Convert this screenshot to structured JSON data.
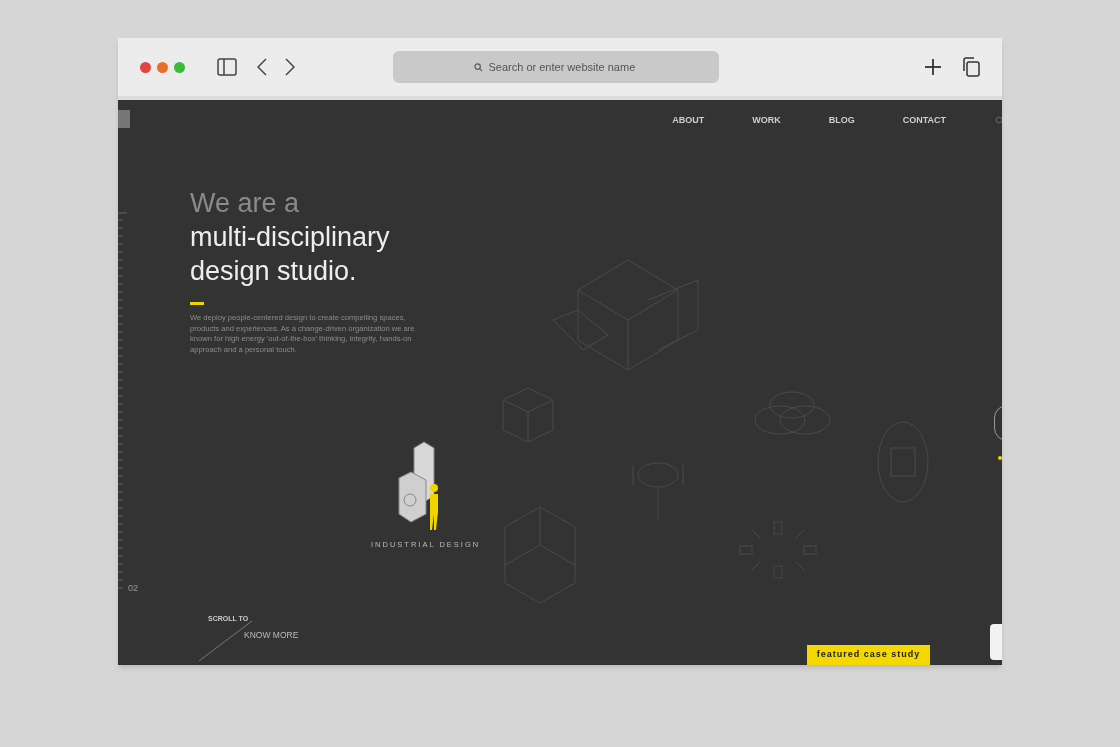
{
  "browser": {
    "address_placeholder": "Search or enter website name"
  },
  "nav": {
    "items": [
      {
        "label": "ABOUT"
      },
      {
        "label": "WORK"
      },
      {
        "label": "BLOG"
      },
      {
        "label": "CONTACT"
      }
    ]
  },
  "hero": {
    "title_line_1": "We are a",
    "title_line_2": "multi-disciplinary",
    "title_line_3": "design studio.",
    "description": "We deploy people-centered design to create compelling spaces, products and experiences. As a change-driven organization we are known for high energy 'out-of-the-box' thinking, integrity, hands-on approach and a personal touch."
  },
  "ruler": {
    "label": "02"
  },
  "featured": {
    "caption": "INDUSTRIAL DESIGN"
  },
  "scroll": {
    "small": "SCROLL TO",
    "large": "KNOW MORE"
  },
  "case_study_button": "featured case study"
}
